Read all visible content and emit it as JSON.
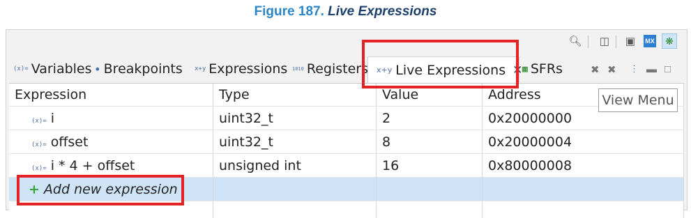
{
  "figure": {
    "number": "Figure 187.",
    "title": "Live Expressions"
  },
  "toolbar": {
    "icons": [
      "search-icon",
      "new-view-icon",
      "display-icon",
      "mx-icon",
      "debug-icon"
    ],
    "mx_label": "MX"
  },
  "tabs": [
    {
      "label": "Variables",
      "icon": "(x)="
    },
    {
      "label": "Breakpoints",
      "icon": "•"
    },
    {
      "label": "Expressions",
      "icon": "x+y"
    },
    {
      "label": "Registers",
      "icon": "1010"
    },
    {
      "label": "Live Expressions",
      "icon": "x+y",
      "active": true
    },
    {
      "label": "SFRs",
      "icon": "▦"
    }
  ],
  "table": {
    "headers": [
      "Expression",
      "Type",
      "Value",
      "Address"
    ],
    "rows": [
      {
        "expression": "i",
        "type": "uint32_t",
        "value": "2",
        "address": "0x20000000"
      },
      {
        "expression": "offset",
        "type": "uint32_t",
        "value": "8",
        "address": "0x20000004"
      },
      {
        "expression": "i * 4 + offset",
        "type": "unsigned int",
        "value": "16",
        "address": "0x80000008"
      }
    ],
    "add_label": "Add new expression",
    "var_icon": "(x)="
  },
  "tooltip": "View Menu",
  "colors": {
    "title_blue": "#2a86c8",
    "highlight_red": "#e32228",
    "selected_row": "#cfe4f7"
  }
}
